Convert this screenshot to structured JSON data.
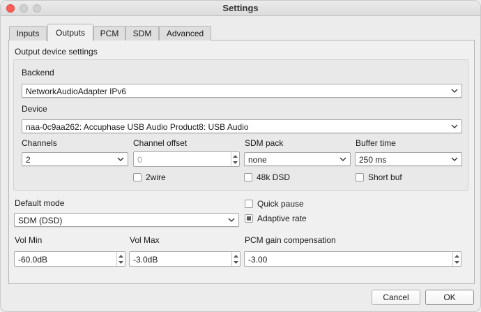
{
  "window": {
    "title": "Settings"
  },
  "tabs": [
    {
      "label": "Inputs",
      "active": false
    },
    {
      "label": "Outputs",
      "active": true
    },
    {
      "label": "PCM",
      "active": false
    },
    {
      "label": "SDM",
      "active": false
    },
    {
      "label": "Advanced",
      "active": false
    }
  ],
  "output": {
    "section_title": "Output device settings",
    "backend": {
      "label": "Backend",
      "value": "NetworkAudioAdapter IPv6"
    },
    "device": {
      "label": "Device",
      "value": "naa-0c9aa262: Accuphase USB Audio Product8: USB Audio"
    },
    "channels": {
      "label": "Channels",
      "value": "2"
    },
    "channel_offset": {
      "label": "Channel offset",
      "value": "0"
    },
    "sdm_pack": {
      "label": "SDM pack",
      "value": "none"
    },
    "buffer_time": {
      "label": "Buffer time",
      "value": "250 ms"
    },
    "twowire": {
      "label": "2wire",
      "checked": false
    },
    "dsd48k": {
      "label": "48k DSD",
      "checked": false
    },
    "short_buf": {
      "label": "Short buf",
      "checked": false
    }
  },
  "default_mode": {
    "label": "Default mode",
    "value": "SDM (DSD)"
  },
  "quick_pause": {
    "label": "Quick pause",
    "checked": false
  },
  "adaptive_rate": {
    "label": "Adaptive rate",
    "checked": true
  },
  "vol_min": {
    "label": "Vol Min",
    "value": "-60.0dB"
  },
  "vol_max": {
    "label": "Vol Max",
    "value": "-3.0dB"
  },
  "pcm_gain": {
    "label": "PCM gain compensation",
    "value": "-3.00"
  },
  "buttons": {
    "cancel": "Cancel",
    "ok": "OK"
  },
  "colors": {
    "close": "#ff5f57",
    "accent": "#5c5c5c"
  }
}
